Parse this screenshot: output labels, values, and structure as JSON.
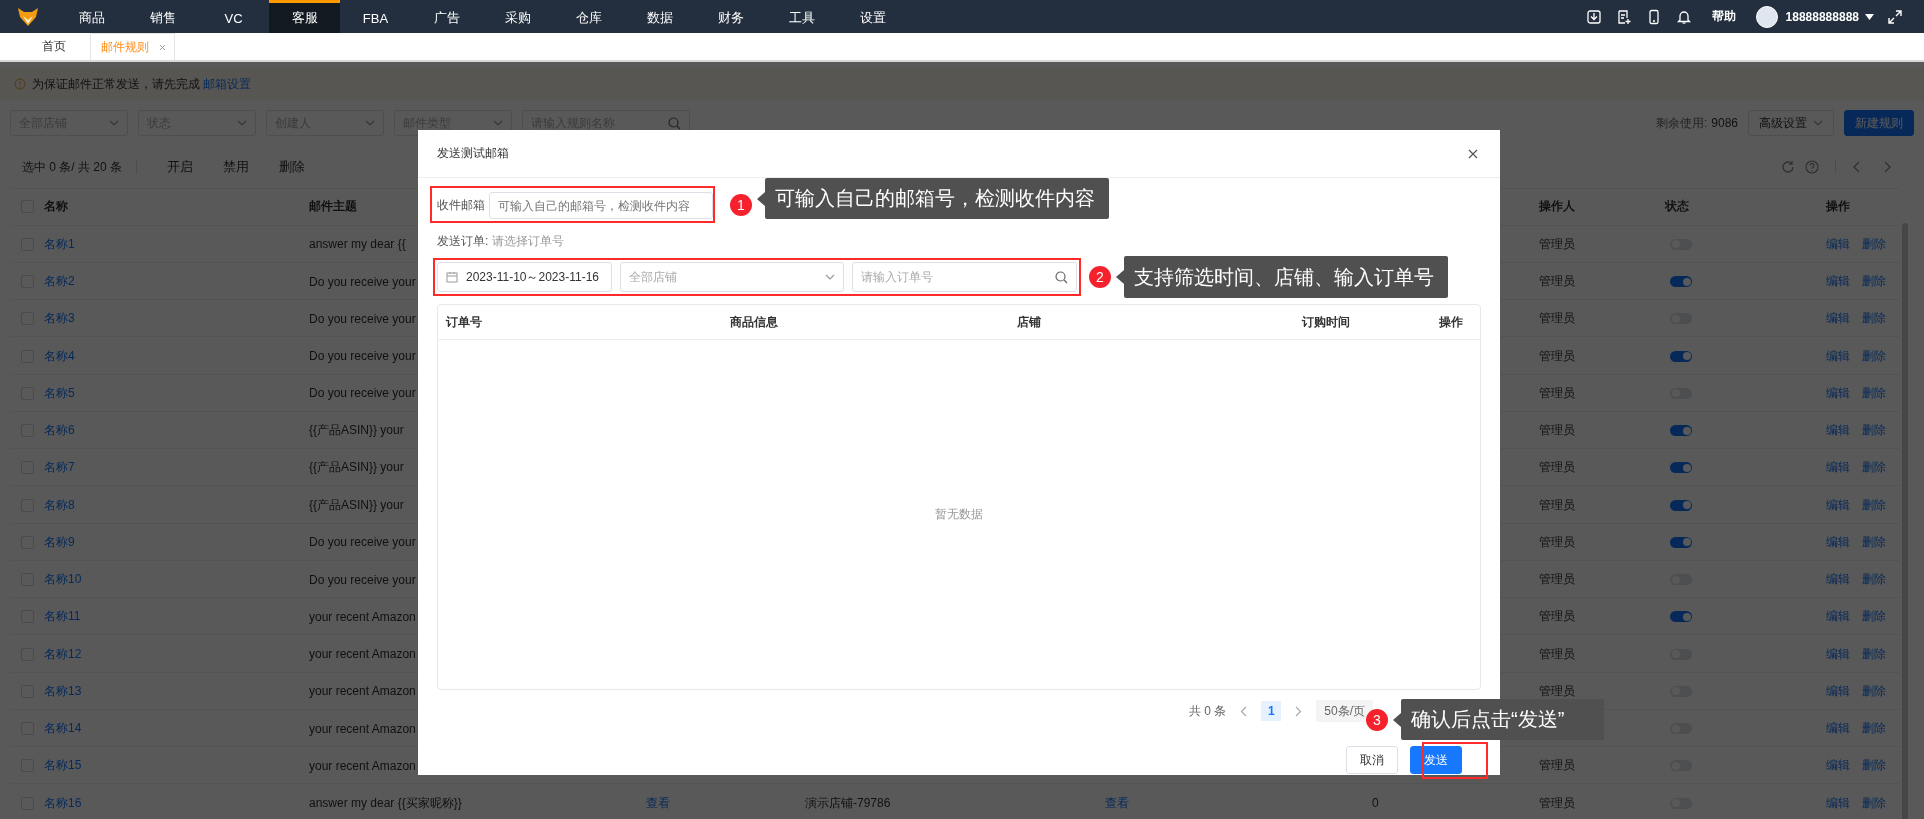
{
  "nav": {
    "items": [
      {
        "label": "商品",
        "selected": false
      },
      {
        "label": "销售",
        "selected": false
      },
      {
        "label": "VC",
        "selected": false
      },
      {
        "label": "客服",
        "selected": true
      },
      {
        "label": "FBA",
        "selected": false
      },
      {
        "label": "广告",
        "selected": false
      },
      {
        "label": "采购",
        "selected": false
      },
      {
        "label": "仓库",
        "selected": false
      },
      {
        "label": "数据",
        "selected": false
      },
      {
        "label": "财务",
        "selected": false
      },
      {
        "label": "工具",
        "selected": false
      },
      {
        "label": "设置",
        "selected": false
      }
    ],
    "help": "帮助",
    "user": "18888888888"
  },
  "tabs": [
    {
      "label": "首页",
      "selected": false,
      "closable": false
    },
    {
      "label": "邮件规则",
      "selected": true,
      "closable": true
    }
  ],
  "notice": {
    "text": "为保证邮件正常发送，请先完成 ",
    "link": "邮箱设置"
  },
  "filters": [
    {
      "kind": "select",
      "placeholder": "全部店铺"
    },
    {
      "kind": "select",
      "placeholder": "状态"
    },
    {
      "kind": "select",
      "placeholder": "创建人"
    },
    {
      "kind": "select",
      "placeholder": "邮件类型"
    },
    {
      "kind": "search",
      "placeholder": "请输入规则名称"
    }
  ],
  "quota": {
    "label": "剩余使用:",
    "value": "9086"
  },
  "header_buttons": [
    {
      "label": "高级设置",
      "kind": "dropdown"
    },
    {
      "label": "新建规则",
      "kind": "primary"
    }
  ],
  "toolbar": {
    "selection": "选中 0 条/ 共 20 条",
    "actions": [
      "开启",
      "禁用",
      "删除"
    ]
  },
  "table": {
    "select_all_checked": false,
    "headers": {
      "name": "名称",
      "subject": "邮件主题",
      "operator": "操作人",
      "status": "状态",
      "actions": "操作"
    },
    "rows": [
      {
        "name": "名称1",
        "subject": "answer my dear {{",
        "checked": false,
        "on": false,
        "operator": "管理员",
        "actions": [
          "编辑",
          "删除"
        ]
      },
      {
        "name": "名称2",
        "subject": "Do you receive your",
        "checked": false,
        "on": true,
        "operator": "管理员",
        "actions": [
          "编辑",
          "删除"
        ]
      },
      {
        "name": "名称3",
        "subject": "Do you receive your",
        "checked": false,
        "on": false,
        "operator": "管理员",
        "actions": [
          "编辑",
          "删除"
        ]
      },
      {
        "name": "名称4",
        "subject": "Do you receive your",
        "checked": false,
        "on": true,
        "operator": "管理员",
        "actions": [
          "编辑",
          "删除"
        ]
      },
      {
        "name": "名称5",
        "subject": "Do you receive your",
        "checked": false,
        "on": false,
        "operator": "管理员",
        "actions": [
          "编辑",
          "删除"
        ]
      },
      {
        "name": "名称6",
        "subject": "{{产品ASIN}} your",
        "checked": false,
        "on": true,
        "operator": "管理员",
        "actions": [
          "编辑",
          "删除"
        ]
      },
      {
        "name": "名称7",
        "subject": "{{产品ASIN}} your",
        "checked": false,
        "on": true,
        "operator": "管理员",
        "actions": [
          "编辑",
          "删除"
        ]
      },
      {
        "name": "名称8",
        "subject": "{{产品ASIN}} your",
        "checked": false,
        "on": true,
        "operator": "管理员",
        "actions": [
          "编辑",
          "删除"
        ]
      },
      {
        "name": "名称9",
        "subject": "Do you receive your",
        "checked": false,
        "on": true,
        "operator": "管理员",
        "actions": [
          "编辑",
          "删除"
        ]
      },
      {
        "name": "名称10",
        "subject": "Do you receive your",
        "checked": false,
        "on": false,
        "operator": "管理员",
        "actions": [
          "编辑",
          "删除"
        ]
      },
      {
        "name": "名称11",
        "subject": "your recent Amazon",
        "checked": false,
        "on": true,
        "operator": "管理员",
        "actions": [
          "编辑",
          "删除"
        ]
      },
      {
        "name": "名称12",
        "subject": "your recent Amazon",
        "checked": false,
        "on": false,
        "operator": "管理员",
        "actions": [
          "编辑",
          "删除"
        ]
      },
      {
        "name": "名称13",
        "subject": "your recent Amazon",
        "checked": false,
        "on": false,
        "operator": "管理员",
        "actions": [
          "编辑",
          "删除"
        ]
      },
      {
        "name": "名称14",
        "subject": "your recent Amazon",
        "checked": false,
        "on": false,
        "actions": [
          "编辑",
          "删除"
        ]
      },
      {
        "name": "名称15",
        "subject": "your recent Amazon",
        "checked": false,
        "on": false,
        "operator": "管理员",
        "actions": [
          "编辑",
          "删除"
        ]
      },
      {
        "name": "名称16",
        "subject": "answer my dear {{买家昵称}}",
        "column_4": "查看",
        "column_5": "演示店铺-79786",
        "column_6": "查看",
        "column_7": "0",
        "checked": false,
        "on": false,
        "operator": "管理员",
        "actions": [
          "编辑",
          "删除"
        ]
      }
    ]
  },
  "modal": {
    "title": "发送测试邮箱",
    "recipient_label": "收件邮箱",
    "recipient_placeholder": "可输入自己的邮箱号，检测收件内容",
    "order_label": "发送订单:",
    "order_hint": "请选择订单号",
    "date_range": "2023-11-10～2023-11-16",
    "store_placeholder": "全部店铺",
    "order_placeholder": "请输入订单号",
    "columns": [
      "订单号",
      "商品信息",
      "店铺",
      "订购时间",
      "操作"
    ],
    "empty": "暂无数据",
    "pagination": {
      "total": "共 0 条",
      "pages": [
        {
          "label": "1",
          "selected": true
        }
      ],
      "page_size": "50条/页"
    },
    "buttons": [
      {
        "label": "取消",
        "kind": "secondary"
      },
      {
        "label": "发送",
        "kind": "primary"
      }
    ]
  },
  "callouts": [
    {
      "number": "1",
      "text": "可输入自己的邮箱号，检测收件内容"
    },
    {
      "number": "2",
      "text": "支持筛选时间、店铺、输入订单号"
    },
    {
      "number": "3",
      "text": "确认后点击“发送”"
    }
  ]
}
